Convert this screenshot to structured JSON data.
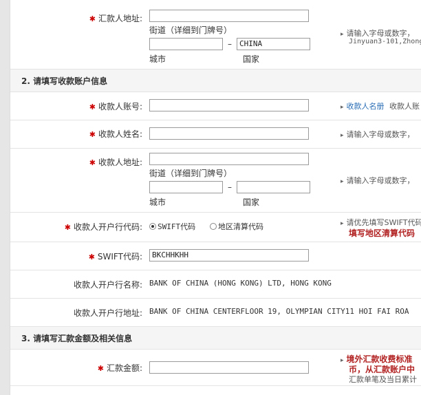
{
  "remitter_address": {
    "label": "汇款人地址:",
    "street_label": "街道（详细到门牌号）",
    "city_label": "城市",
    "country_label": "国家",
    "country_value": "CHINA",
    "dash": "–",
    "hint": "请输入字母或数字，",
    "hint_example": "Jinyuan3-101,Zhong"
  },
  "section2": {
    "title": "2. 请填写收款账户信息"
  },
  "payee_account": {
    "label": "收款人账号:",
    "hint_link": "收款人名册",
    "hint_rest": "收款人账"
  },
  "payee_name": {
    "label": "收款人姓名:",
    "hint": "请输入字母或数字，"
  },
  "payee_address": {
    "label": "收款人地址:",
    "street_label": "街道（详细到门牌号）",
    "city_label": "城市",
    "country_label": "国家",
    "dash": "–",
    "hint": "请输入字母或数字，"
  },
  "payee_bank_code": {
    "label": "收款人开户行代码:",
    "option_swift": "SWIFT代码",
    "option_region": "地区清算代码",
    "hint": "请优先填写SWIFT代码",
    "hint_red": "填写地区清算代码"
  },
  "swift_code": {
    "label": "SWIFT代码:",
    "value": "BKCHHKHH"
  },
  "bank_name": {
    "label": "收款人开户行名称:",
    "value": "BANK OF CHINA (HONG KONG) LTD, HONG KONG"
  },
  "bank_address": {
    "label": "收款人开户行地址:",
    "value": "BANK OF CHINA CENTERFLOOR 19, OLYMPIAN CITY11 HOI FAI ROA"
  },
  "section3": {
    "title": "3. 请填写汇款金额及相关信息"
  },
  "amount": {
    "label": "汇款金额:",
    "hint_red1": "境外汇款收费标准",
    "hint_red2": "币，从汇款账户中",
    "hint_gray": "汇款单笔及当日累计"
  }
}
